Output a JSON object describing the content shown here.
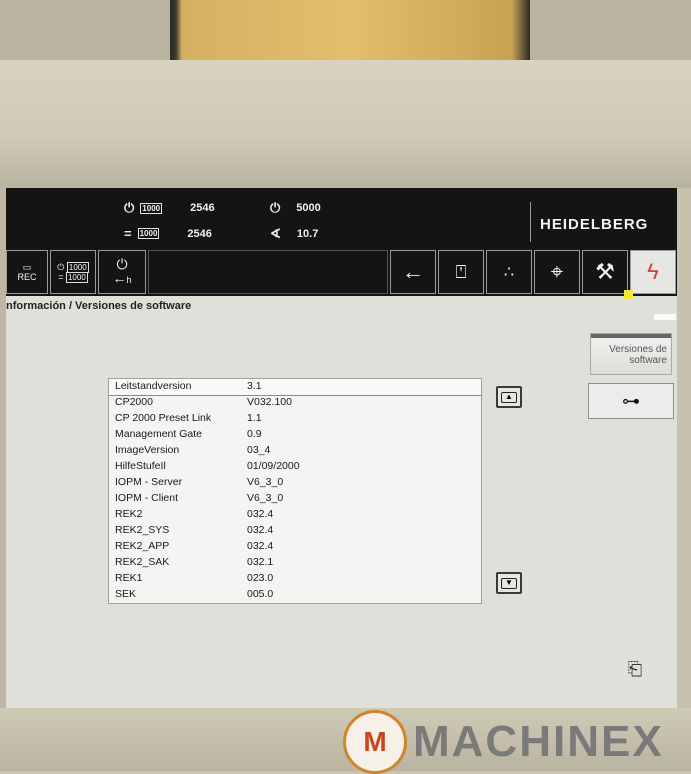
{
  "status": {
    "row1_value": "2546",
    "row2_value": "2546",
    "counter_label": "1000",
    "speed": "5000",
    "angle": "10.7"
  },
  "toolbar": {
    "rec_label": "REC",
    "mini_counter": "1000",
    "back_h_label": "h"
  },
  "brand": "HEIDELBERG",
  "breadcrumb": "nformación / Versiones de software",
  "sidebar": {
    "versions_button": "Versiones de software"
  },
  "versions": [
    {
      "name": "Leitstandversion",
      "value": "3.1"
    },
    {
      "name": "CP2000",
      "value": "V032.100"
    },
    {
      "name": "CP 2000 Preset Link",
      "value": "1.1"
    },
    {
      "name": "Management Gate",
      "value": "0.9"
    },
    {
      "name": "ImageVersion",
      "value": "03_4"
    },
    {
      "name": "HilfeStufeIl",
      "value": "01/09/2000"
    },
    {
      "name": "IOPM - Server",
      "value": "V6_3_0"
    },
    {
      "name": "IOPM - Client",
      "value": "V6_3_0"
    },
    {
      "name": "REK2",
      "value": "032.4"
    },
    {
      "name": "REK2_SYS",
      "value": "032.4"
    },
    {
      "name": "REK2_APP",
      "value": "032.4"
    },
    {
      "name": "REK2_SAK",
      "value": "032.1"
    },
    {
      "name": "REK1",
      "value": "023.0"
    },
    {
      "name": "SEK",
      "value": "005.0"
    }
  ],
  "watermark": "MACHINEX",
  "watermark_logo": "M"
}
